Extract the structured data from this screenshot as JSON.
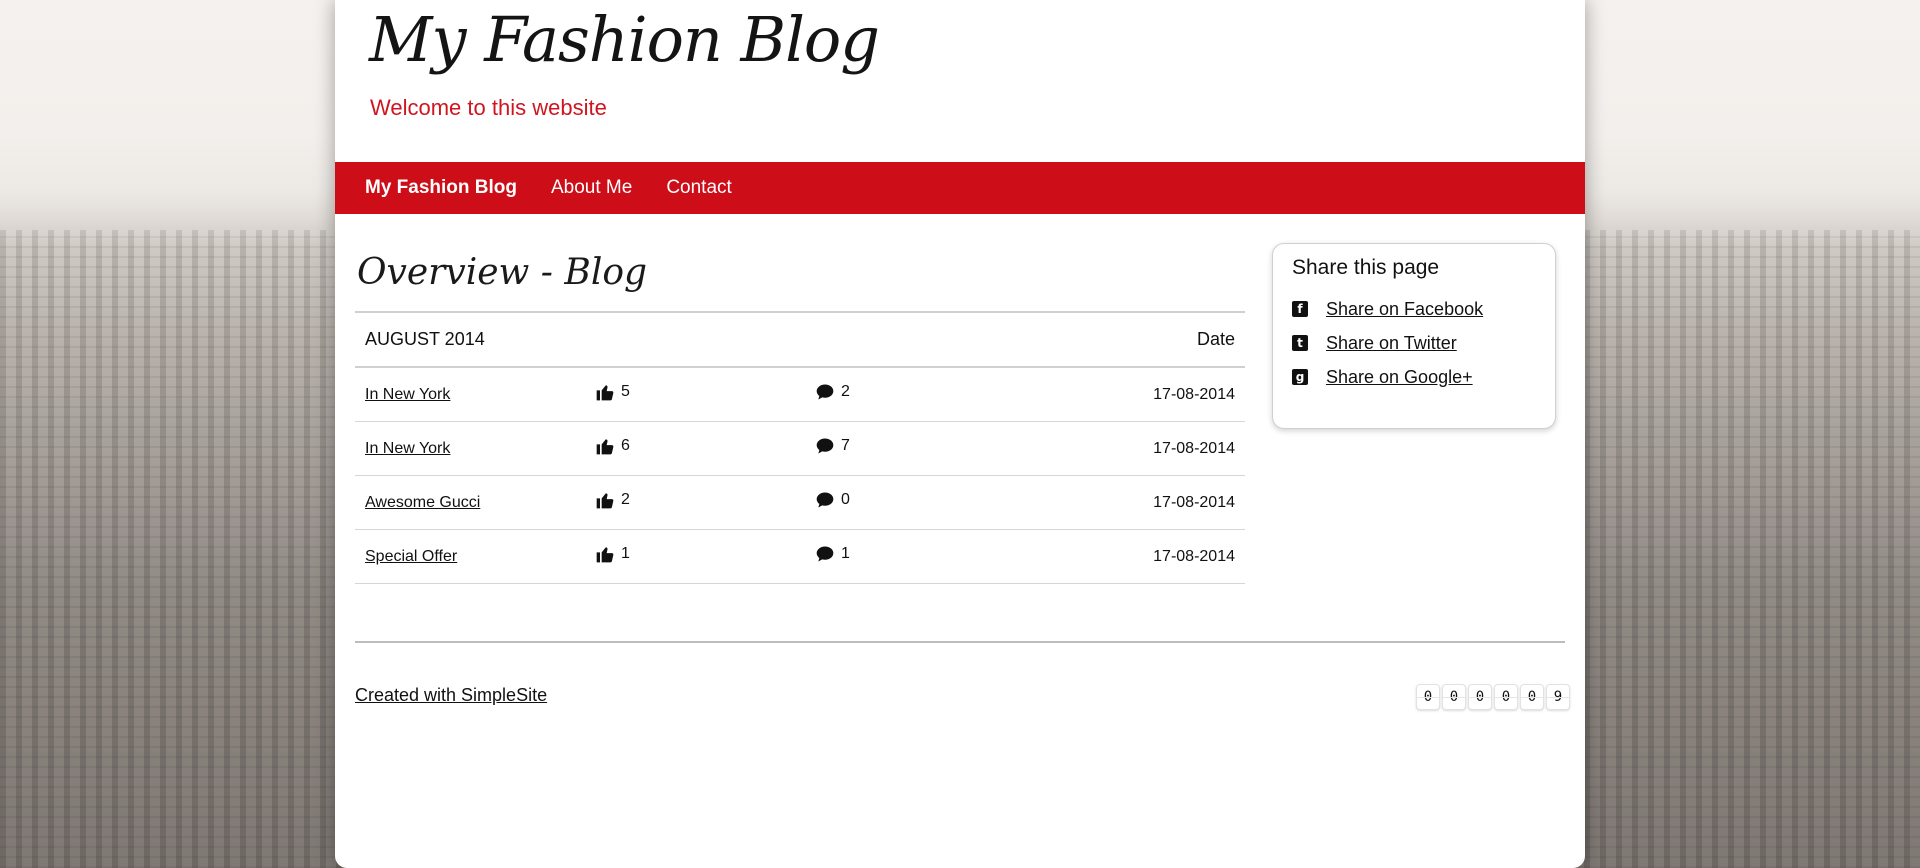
{
  "site": {
    "title": "My Fashion Blog",
    "subtitle": "Welcome to this website"
  },
  "nav": {
    "items": [
      {
        "label": "My Fashion Blog"
      },
      {
        "label": "About Me"
      },
      {
        "label": "Contact"
      }
    ]
  },
  "main": {
    "heading": "Overview - Blog",
    "table": {
      "month_header": "AUGUST 2014",
      "date_header": "Date",
      "rows": [
        {
          "title": "In New York",
          "likes": "5",
          "comments": "2",
          "date": "17-08-2014"
        },
        {
          "title": "In New York",
          "likes": "6",
          "comments": "7",
          "date": "17-08-2014"
        },
        {
          "title": "Awesome Gucci",
          "likes": "2",
          "comments": "0",
          "date": "17-08-2014"
        },
        {
          "title": "Special Offer",
          "likes": "1",
          "comments": "1",
          "date": "17-08-2014"
        }
      ]
    }
  },
  "share": {
    "title": "Share this page",
    "items": [
      {
        "label": "Share on Facebook",
        "icon": "facebook-icon"
      },
      {
        "label": "Share on Twitter",
        "icon": "twitter-icon"
      },
      {
        "label": "Share on Google+",
        "icon": "google-plus-icon"
      }
    ]
  },
  "footer": {
    "created_with": "Created with SimpleSite",
    "counter_digits": [
      "0",
      "0",
      "0",
      "0",
      "0",
      "9"
    ]
  },
  "colors": {
    "accent": "#cd0d18",
    "subtitle": "#cf1620"
  }
}
